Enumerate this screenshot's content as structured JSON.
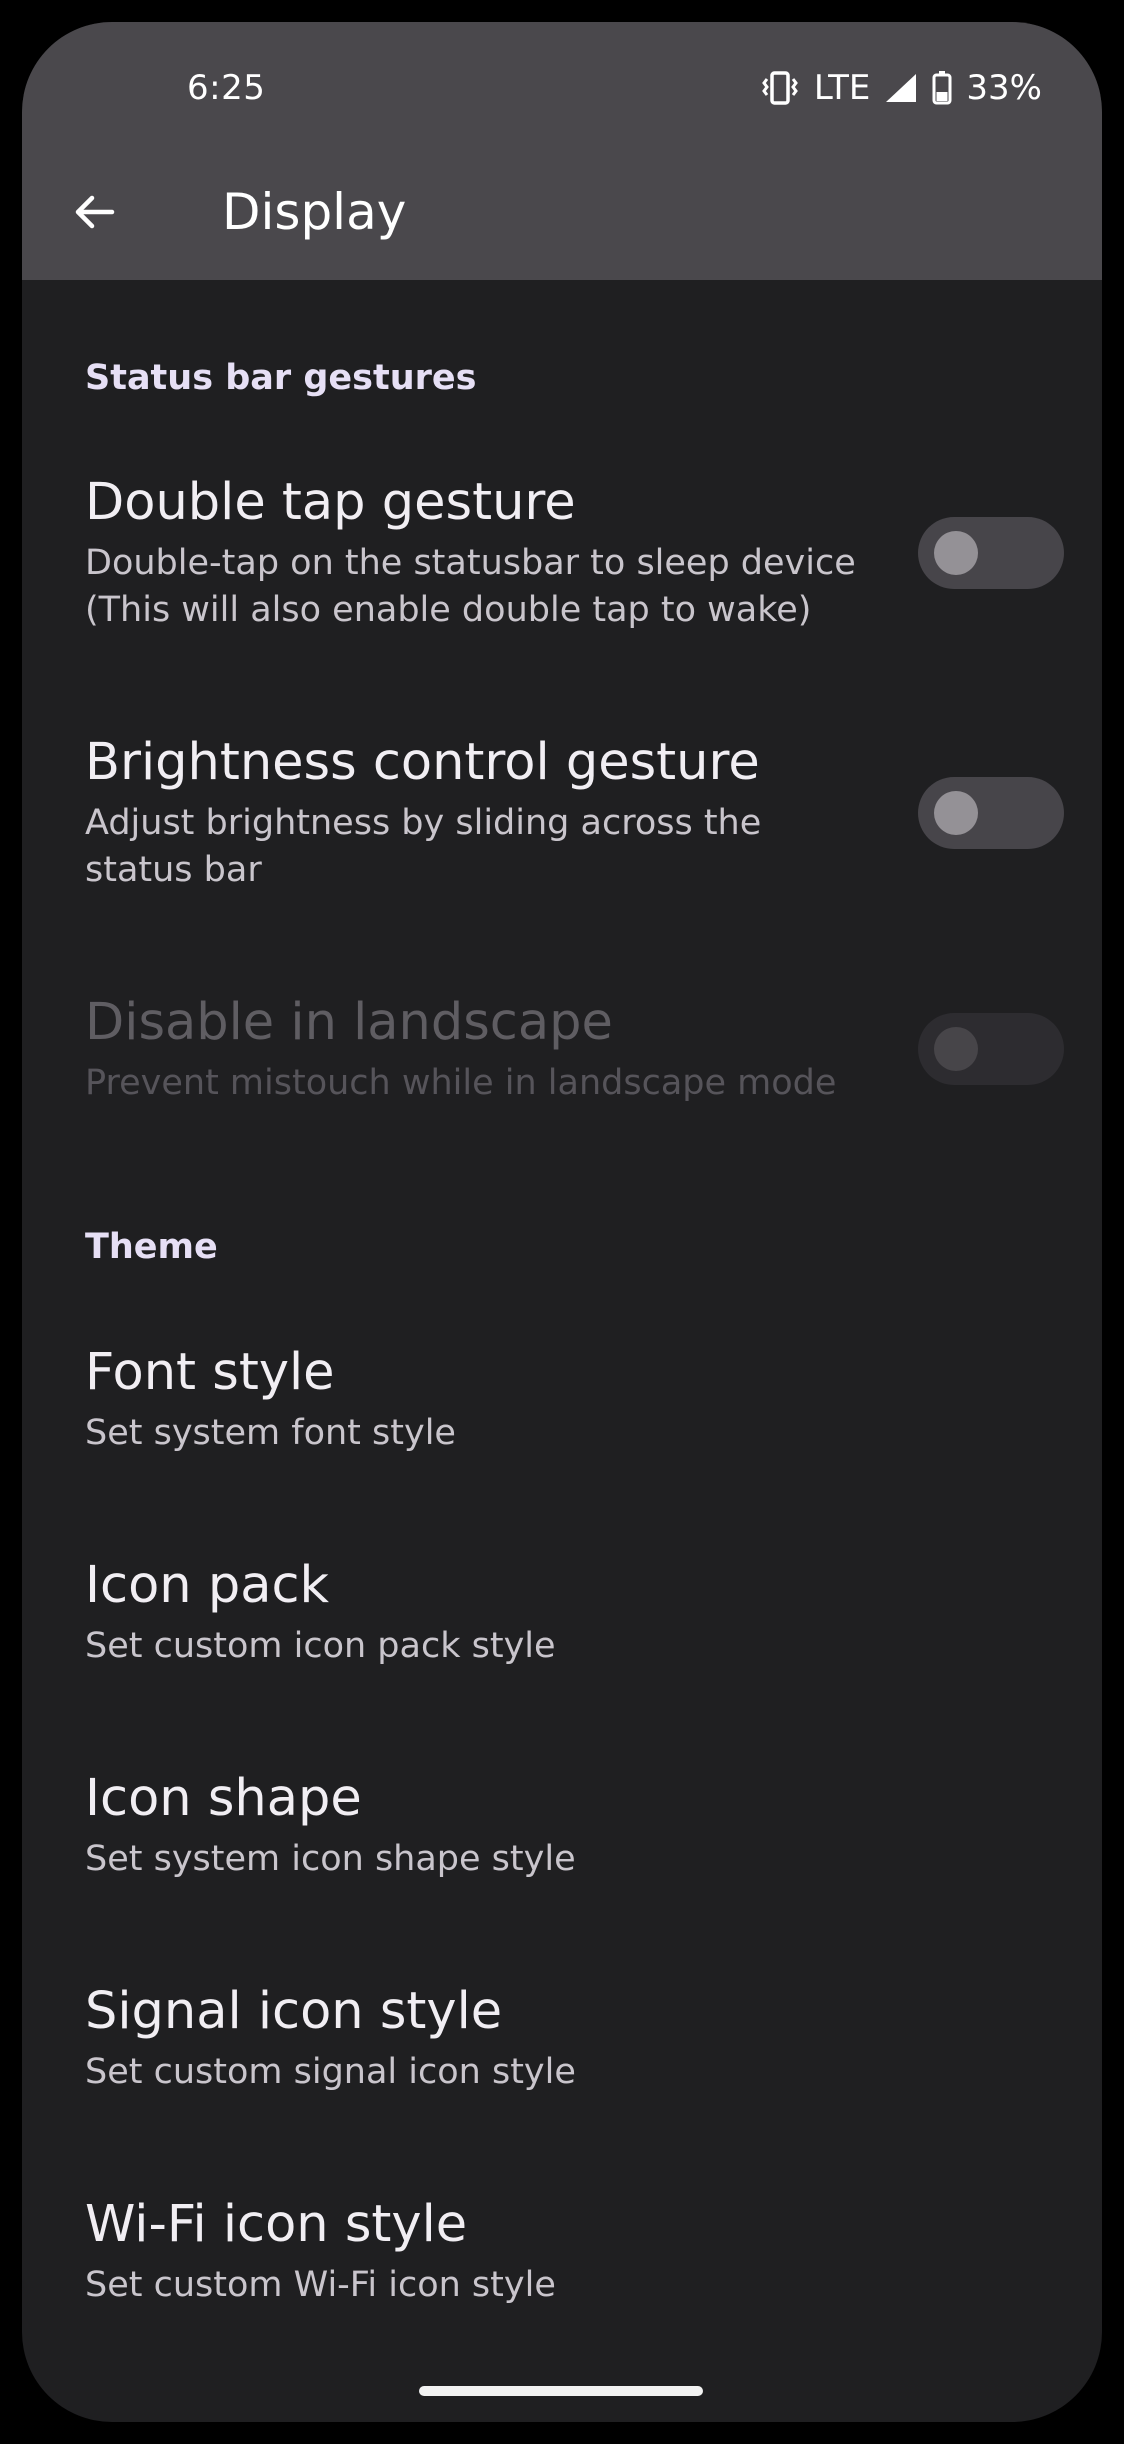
{
  "status_bar": {
    "time": "6:25",
    "network": "LTE",
    "battery": "33%",
    "icons": [
      "vibrate-icon",
      "signal-icon",
      "battery-icon"
    ]
  },
  "app_bar": {
    "back_icon": "arrow-back-icon",
    "title": "Display"
  },
  "sections": {
    "status_bar_gestures": {
      "header": "Status bar gestures",
      "double_tap": {
        "title": "Double tap gesture",
        "summary": "Double-tap on the statusbar to sleep device (This will also enable double tap to wake)",
        "enabled": false
      },
      "brightness": {
        "title": "Brightness control gesture",
        "summary": "Adjust brightness by sliding across the status bar",
        "enabled": false
      },
      "landscape": {
        "title": "Disable in landscape",
        "summary": "Prevent mistouch while in landscape mode",
        "enabled": false,
        "disabled": true
      }
    },
    "theme": {
      "header": "Theme",
      "font_style": {
        "title": "Font style",
        "summary": "Set system font style"
      },
      "icon_pack": {
        "title": "Icon pack",
        "summary": "Set custom icon pack style"
      },
      "icon_shape": {
        "title": "Icon shape",
        "summary": "Set system icon shape style"
      },
      "signal_icon": {
        "title": "Signal icon style",
        "summary": "Set custom signal icon style"
      },
      "wifi_icon": {
        "title": "Wi-Fi icon style",
        "summary": "Set custom Wi-Fi icon style"
      }
    }
  },
  "colors": {
    "app_bar": "#4a484c",
    "background": "#1f1f21",
    "section_header": "#e6dff5",
    "switch_track_off": "#47454a"
  }
}
